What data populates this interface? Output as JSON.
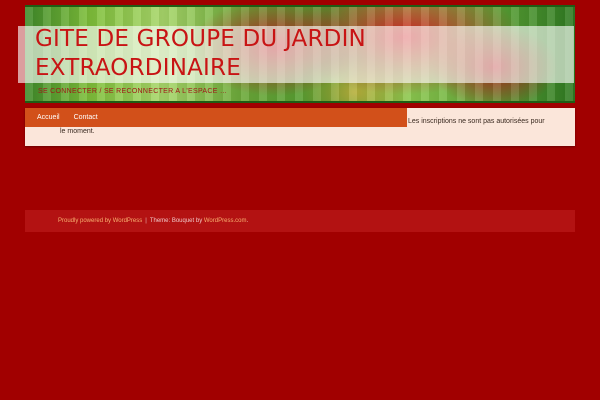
{
  "header": {
    "site_title": "GITE DE GROUPE DU JARDIN EXTRAORDINAIRE",
    "tagline": "SE CONNECTER / SE RECONNECTER A L'ESPACE …"
  },
  "nav": {
    "items": [
      {
        "label": "Accueil"
      },
      {
        "label": "Contact"
      }
    ]
  },
  "content": {
    "notice_part1": "Les inscriptions ne sont pas autorisées pour",
    "notice_part2": "le moment."
  },
  "footer": {
    "powered_by": "Proudly powered by WordPress",
    "separator": "|",
    "theme_prefix": "Theme: Bouquet by",
    "theme_author": "WordPress.com",
    "period": "."
  },
  "colors": {
    "page_background": "#a10000",
    "title": "#c81414",
    "nav_background": "#d2501a",
    "content_background": "#fbe6da",
    "footer_background": "#b31212",
    "footer_link": "#f8b070"
  }
}
